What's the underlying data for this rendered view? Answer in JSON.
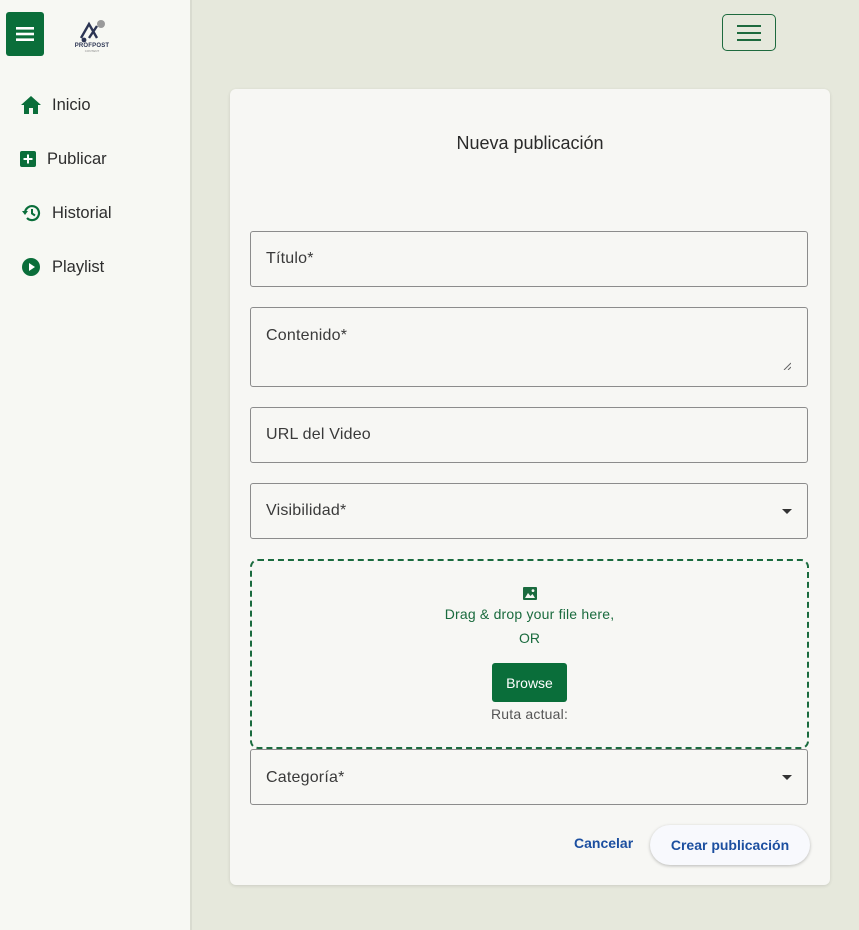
{
  "brand": {
    "logo_text": "PROFPOST",
    "logo_sub": "CONTENT"
  },
  "sidebar": {
    "items": [
      {
        "label": "Inicio",
        "icon": "home-icon"
      },
      {
        "label": "Publicar",
        "icon": "add-box-icon"
      },
      {
        "label": "Historial",
        "icon": "history-icon"
      },
      {
        "label": "Playlist",
        "icon": "play-circle-icon"
      }
    ]
  },
  "form": {
    "title": "Nueva publicación",
    "fields": {
      "titulo": "Título*",
      "contenido": "Contenido*",
      "url": "URL del Video",
      "visibilidad": "Visibilidad*",
      "categoria": "Categoría*"
    },
    "dropzone": {
      "text": "Drag & drop your file here,",
      "or": "OR",
      "browse": "Browse",
      "path_label": "Ruta actual:"
    },
    "actions": {
      "cancel": "Cancelar",
      "submit": "Crear publicación"
    }
  },
  "colors": {
    "primary": "#0a6e3a",
    "link": "#1c4fa0",
    "background": "#e6e8dc",
    "card": "#f7f7f4"
  }
}
